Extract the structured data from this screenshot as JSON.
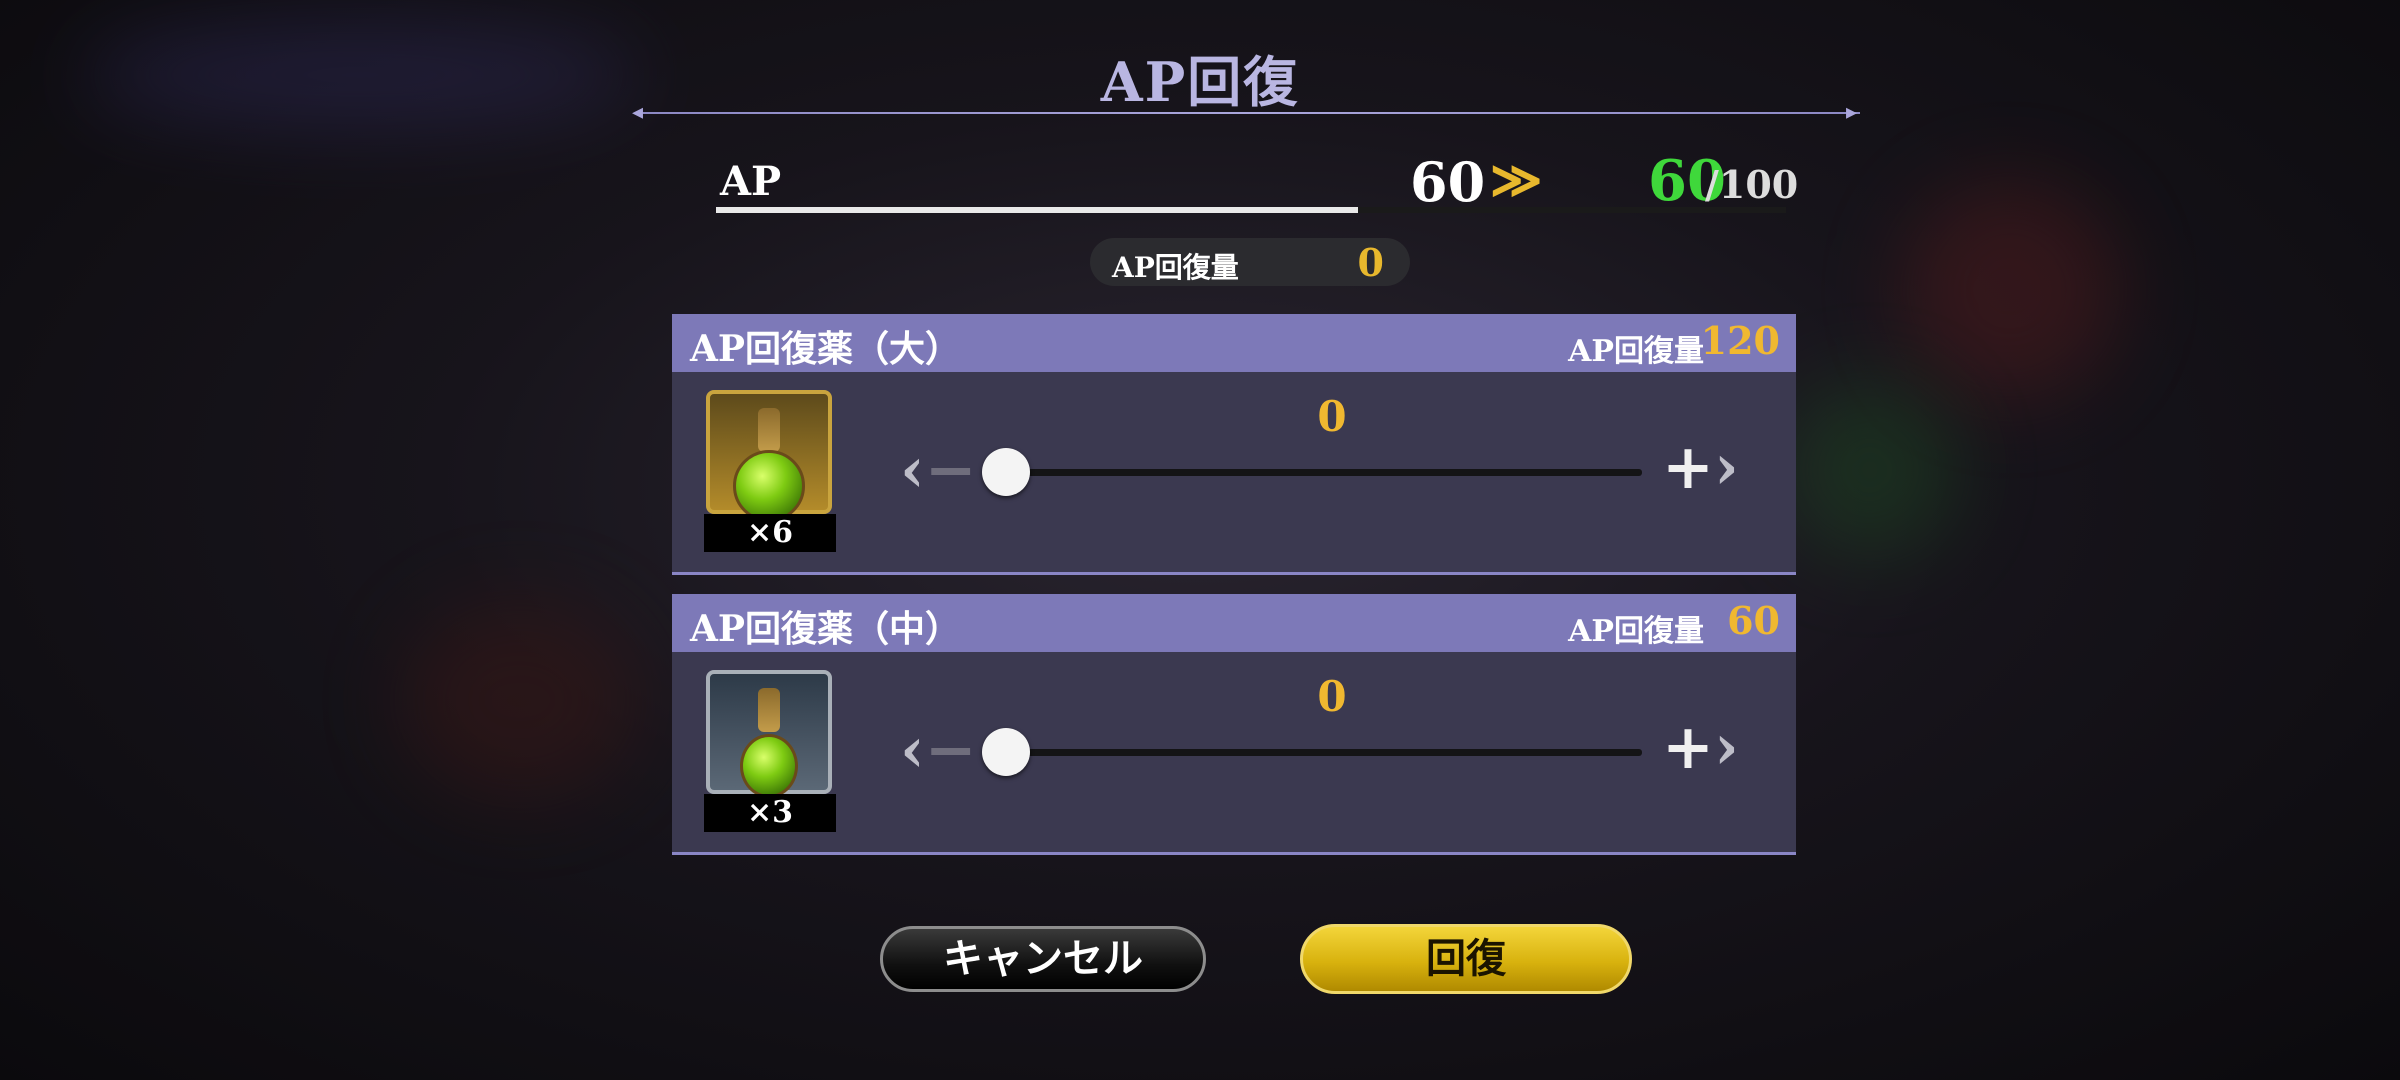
{
  "title": "AP回復",
  "ap": {
    "label": "AP",
    "current": "60",
    "arrow": "≫",
    "after": "60",
    "max": "/100",
    "fill_ratio": 0.6
  },
  "recover_summary": {
    "label": "AP回復量",
    "value": "0"
  },
  "items": [
    {
      "name": "AP回復薬（大）",
      "recover_label": "AP回復量",
      "recover_value": "120",
      "count": "×6",
      "quantity": "0",
      "frame": "gold"
    },
    {
      "name": "AP回復薬（中）",
      "recover_label": "AP回復量",
      "recover_value": "60",
      "count": "×3",
      "quantity": "0",
      "frame": "silver"
    }
  ],
  "buttons": {
    "cancel": "キャンセル",
    "recover": "回復"
  },
  "icons": {
    "minus": "minus-chevron-left-icon",
    "plus": "plus-chevron-right-icon",
    "potion": "potion-icon"
  },
  "colors": {
    "accent_gold": "#f0b830",
    "ap_after_green": "#3fd83b",
    "panel_header": "#7d79b8",
    "panel_body": "#3b3950"
  }
}
